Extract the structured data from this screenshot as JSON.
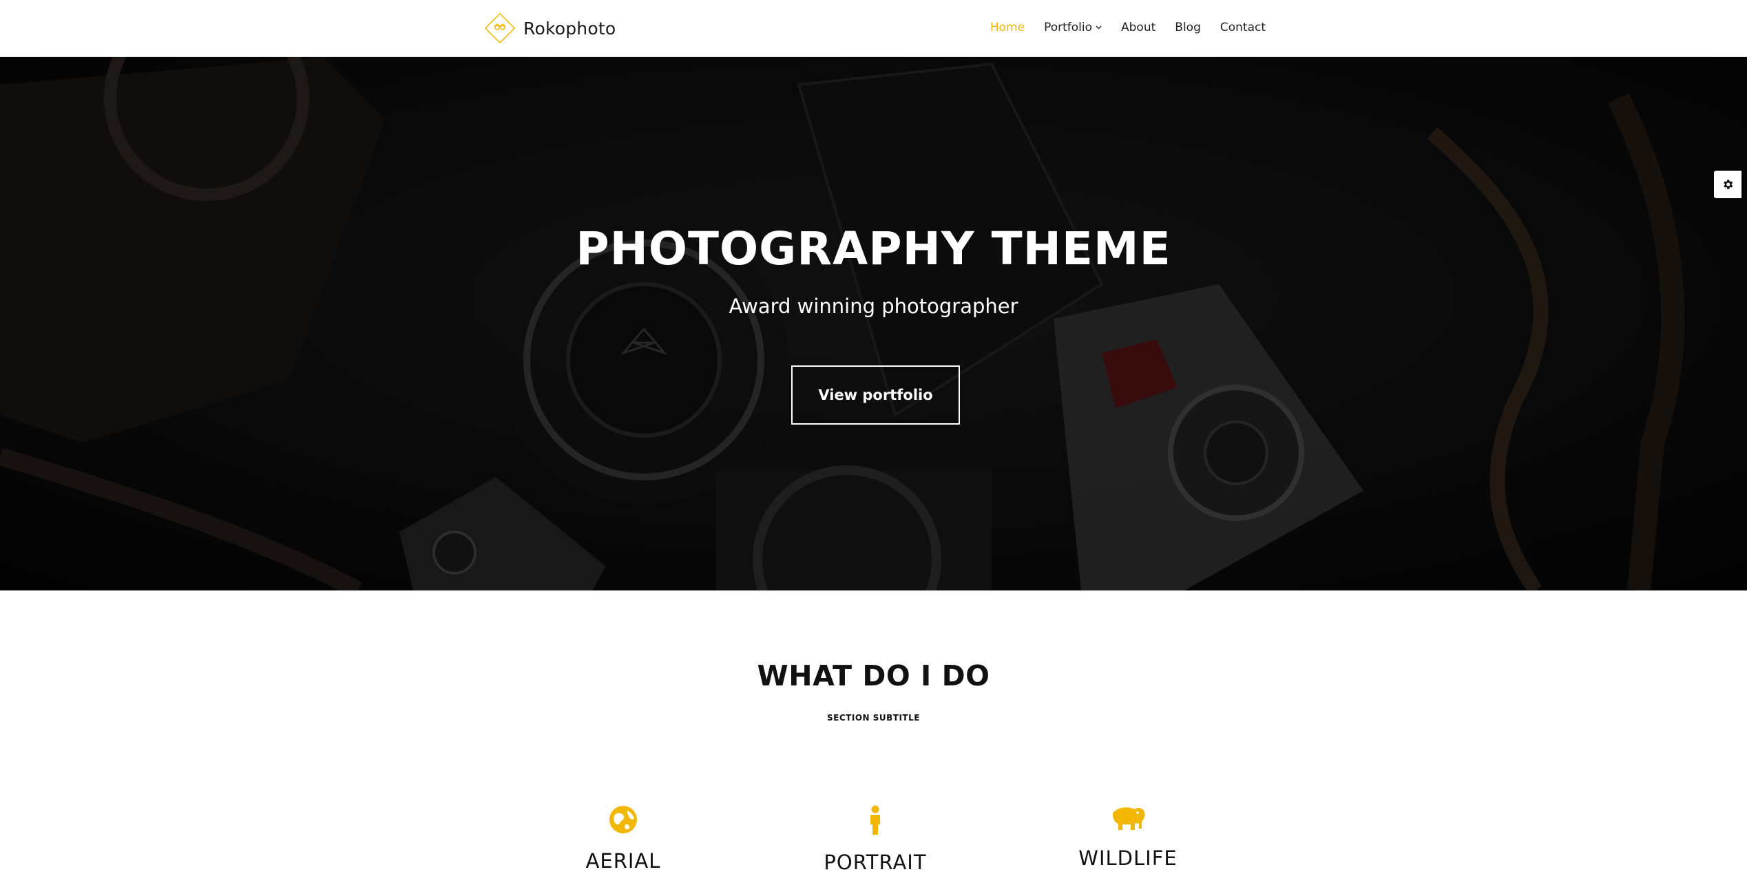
{
  "brand": {
    "name": "Rokophoto",
    "logo_icon": "diamond-logo-icon"
  },
  "nav": {
    "items": [
      {
        "label": "Home",
        "active": true
      },
      {
        "label": "Portfolio",
        "has_dropdown": true
      },
      {
        "label": "About"
      },
      {
        "label": "Blog"
      },
      {
        "label": "Contact"
      }
    ]
  },
  "hero": {
    "title": "PHOTOGRAPHY THEME",
    "subtitle": "Award winning photographer",
    "button_label": "View portfolio"
  },
  "settings": {
    "icon": "gear-icon"
  },
  "services_section": {
    "title": "WHAT DO I DO",
    "subtitle": "SECTION SUBTITLE",
    "items": [
      {
        "label": "AERIAL",
        "icon": "globe-icon"
      },
      {
        "label": "PORTRAIT",
        "icon": "person-icon"
      },
      {
        "label": "WILDLIFE",
        "icon": "elephant-icon"
      }
    ]
  },
  "colors": {
    "accent": "#f2b705",
    "text": "#111111",
    "hero_overlay": "#0b0b0b"
  }
}
